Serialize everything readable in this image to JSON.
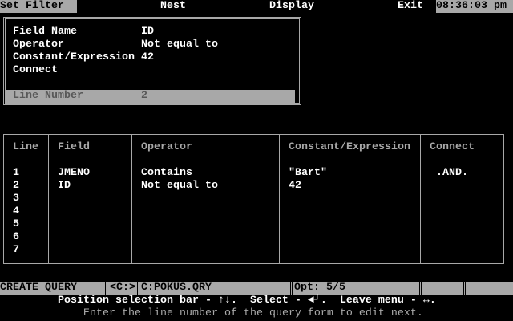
{
  "menu": {
    "items": [
      "Set Filter",
      "Nest",
      "Display",
      "Exit"
    ],
    "clock": "08:36:03 pm"
  },
  "editor": {
    "field_name_label": "Field Name",
    "field_name": "ID",
    "operator_label": "Operator",
    "operator": "Not equal to",
    "constant_label": "Constant/Expression",
    "constant": "42",
    "connect_label": "Connect",
    "connect": "",
    "line_number_label": "Line Number",
    "line_number": "2"
  },
  "table": {
    "headers": [
      "Line",
      "Field",
      "Operator",
      "Constant/Expression",
      "Connect"
    ],
    "rows": [
      {
        "line": "1",
        "field": "JMENO",
        "operator": "Contains",
        "constant": "\"Bart\"",
        "connect": ".AND."
      },
      {
        "line": "2",
        "field": "ID",
        "operator": "Not equal to",
        "constant": "42",
        "connect": ""
      },
      {
        "line": "3",
        "field": "",
        "operator": "",
        "constant": "",
        "connect": ""
      },
      {
        "line": "4",
        "field": "",
        "operator": "",
        "constant": "",
        "connect": ""
      },
      {
        "line": "5",
        "field": "",
        "operator": "",
        "constant": "",
        "connect": ""
      },
      {
        "line": "6",
        "field": "",
        "operator": "",
        "constant": "",
        "connect": ""
      },
      {
        "line": "7",
        "field": "",
        "operator": "",
        "constant": "",
        "connect": ""
      }
    ]
  },
  "status": {
    "mode": "CREATE QUERY",
    "drive": "<C:>",
    "file": "C:POKUS.QRY",
    "opt": "Opt: 5/5"
  },
  "help": {
    "nav": "Position selection bar - ↑↓.  Select - ◄┘.  Leave menu - ↔.",
    "message": "Enter the line number of the query form to edit next."
  }
}
